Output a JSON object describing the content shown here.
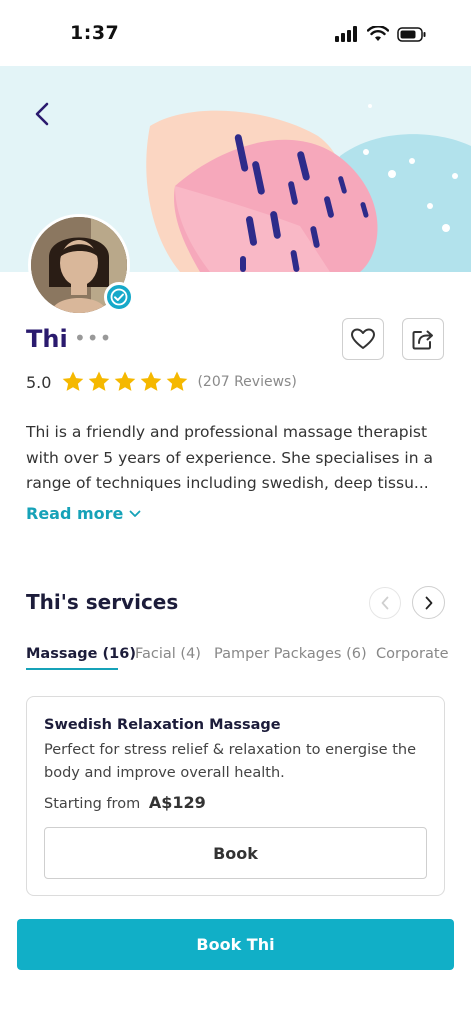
{
  "status_bar": {
    "time": "1:37"
  },
  "provider": {
    "name": "Thi",
    "more_label": "•••",
    "rating": "5.0",
    "stars": 5,
    "reviews": "(207 Reviews)",
    "bio_lines": [
      "Thi is a friendly and professional massage therapist",
      "with over 5 years of experience. She specialises in a",
      "range of techniques including swedish, deep tissu..."
    ],
    "read_more": "Read more"
  },
  "services": {
    "title": "Thi's services",
    "tabs": [
      {
        "label": "Massage (16)",
        "active": true
      },
      {
        "label": "Facial (4)",
        "active": false
      },
      {
        "label": "Pamper Packages (6)",
        "active": false
      },
      {
        "label": "Corporate",
        "active": false
      }
    ],
    "card": {
      "title": "Swedish Relaxation Massage",
      "description": "Perfect for stress relief & relaxation to energise the body and improve overall health.",
      "starting_from": "Starting from",
      "price": "A$129",
      "book_label": "Book"
    }
  },
  "cta": {
    "label": "Book Thi"
  },
  "colors": {
    "accent": "#11afc7",
    "name": "#2a1a6e",
    "star": "#f5b800"
  },
  "icons": [
    "back-chevron-icon",
    "heart-icon",
    "share-icon",
    "verified-badge-icon",
    "chevron-down-icon",
    "chevron-left-icon",
    "chevron-right-icon",
    "signal-icon",
    "wifi-icon",
    "battery-icon",
    "star-icon"
  ]
}
